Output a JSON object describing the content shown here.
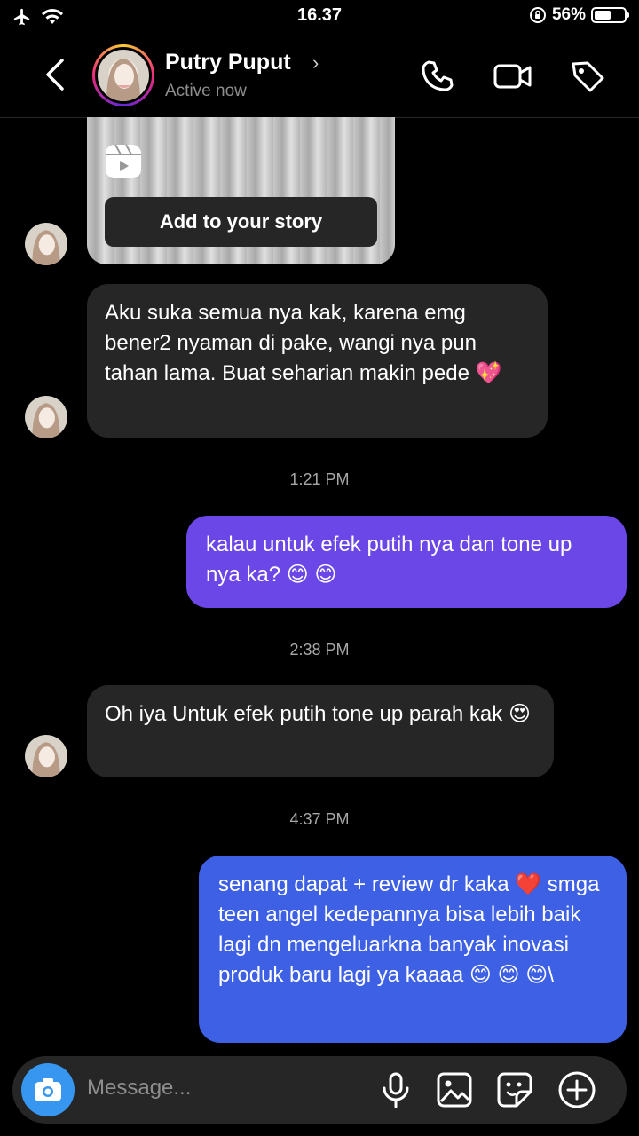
{
  "status_bar": {
    "time": "16.37",
    "battery_percent": "56%",
    "battery_level": 0.56
  },
  "header": {
    "name": "Putry Puput",
    "status": "Active now"
  },
  "shared_media": {
    "button_label": "Add to your story"
  },
  "messages": [
    {
      "direction": "in",
      "text": "Aku suka semua nya kak, karena emg bener2 nyaman di pake, wangi nya pun tahan lama. Buat seharian makin pede 💖"
    },
    {
      "timestamp": "1:21 PM"
    },
    {
      "direction": "out",
      "text": "kalau untuk efek putih nya dan tone up nya ka? 😊 😊"
    },
    {
      "timestamp": "2:38 PM"
    },
    {
      "direction": "in",
      "text": "Oh iya Untuk efek putih tone up parah kak 😍"
    },
    {
      "timestamp": "4:37 PM"
    },
    {
      "direction": "out",
      "text": "senang dapat + review dr kaka ❤️ smga teen angel kedepannya bisa lebih baik lagi dn mengeluarkna banyak inovasi produk baru lagi ya kaaaa 😊 😊 😊\\"
    }
  ],
  "composer": {
    "placeholder": "Message..."
  },
  "colors": {
    "outgoing_top": "#7244e8",
    "outgoing_bottom": "#3a5fe3",
    "incoming": "#262626",
    "camera": "#3797f0"
  },
  "icons": [
    "airplane-icon",
    "wifi-icon",
    "orientation-lock-icon",
    "back-icon",
    "phone-icon",
    "video-icon",
    "tag-icon",
    "reel-icon",
    "camera-icon",
    "microphone-icon",
    "gallery-icon",
    "sticker-icon",
    "plus-icon"
  ]
}
